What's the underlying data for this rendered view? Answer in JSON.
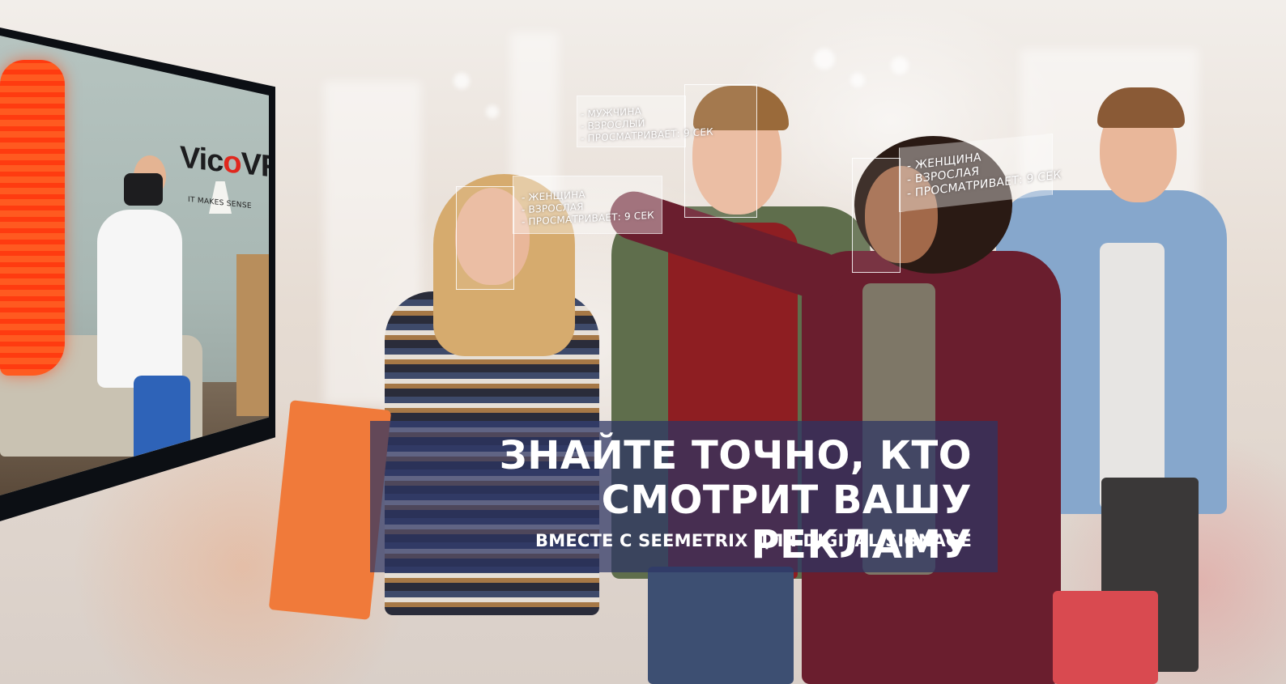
{
  "banner": {
    "headline_line1": "ЗНАЙТЕ ТОЧНО, КТО",
    "headline_line2": "СМОТРИТ ВАШУ РЕКЛАМУ",
    "subline": "ВМЕСТЕ С SEEMETRIX ДЛЯ DIGITAL SIGNAGE"
  },
  "tv": {
    "brand_left": "Vic",
    "brand_mid": "o",
    "brand_right": "VR",
    "tagline": "IT MAKES SENSE"
  },
  "detections": [
    {
      "gender": "- ЖЕНЩИНА",
      "age": "- ВЗРОСЛАЯ",
      "watch": "- ПРОСМАТРИВАЕТ: 9 СЕК"
    },
    {
      "gender": "- МУЖЧИНА",
      "age": "- ВЗРОСЛЫЙ",
      "watch": "- ПРОСМАТРИВАЕТ: 9 СЕК"
    },
    {
      "gender": "- ЖЕНЩИНА",
      "age": "- ВЗРОСЛАЯ",
      "watch": "- ПРОСМАТРИВАЕТ: 9 СЕК"
    }
  ],
  "colors": {
    "banner_bg": "#2d3464",
    "brand_accent": "#e0281e",
    "text": "#ffffff"
  }
}
